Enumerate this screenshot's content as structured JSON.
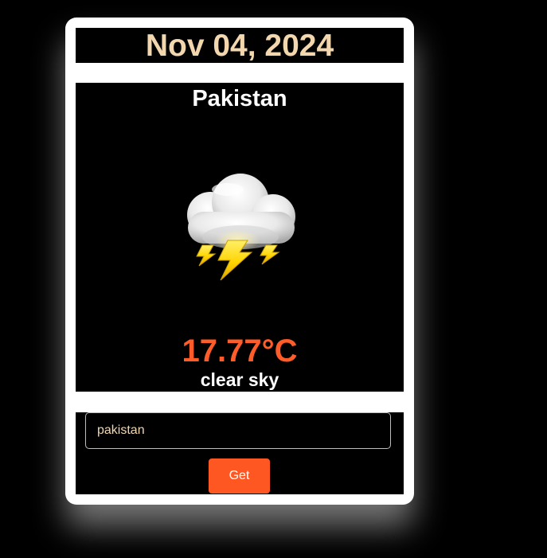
{
  "header": {
    "date": "Nov 04, 2024"
  },
  "weather": {
    "country": "Pakistan",
    "temperature": "17.77°C",
    "description": "clear sky",
    "icon": "thunder-cloud-icon"
  },
  "search": {
    "input_value": "pakistan",
    "button_label": "Get"
  },
  "colors": {
    "background": "#000000",
    "card": "#ffffff",
    "date_text": "#f2d6ae",
    "temperature": "#ff5c2a",
    "button": "#ff5722"
  }
}
